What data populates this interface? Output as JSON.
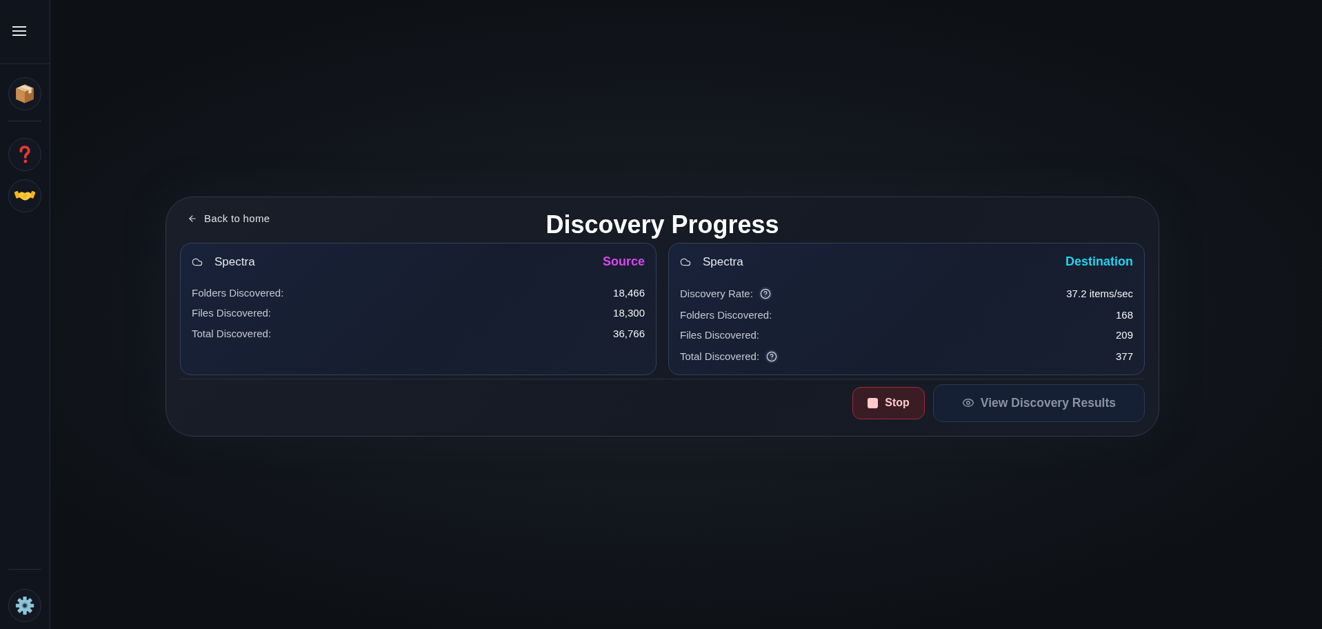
{
  "back_link": {
    "label": "Back to home"
  },
  "title": "Discovery Progress",
  "panels": [
    {
      "name": "Spectra",
      "role": "Source",
      "color": "#d946ef",
      "rows": [
        {
          "label": "Folders Discovered:",
          "value": "18,466",
          "help": false
        },
        {
          "label": "Files Discovered:",
          "value": "18,300",
          "help": false
        },
        {
          "label": "Total Discovered:",
          "value": "36,766",
          "help": false
        }
      ]
    },
    {
      "name": "Spectra",
      "role": "Destination",
      "color": "#22d3ee",
      "rows": [
        {
          "label": "Discovery Rate:",
          "value": "37.2 items/sec",
          "help": true
        },
        {
          "label": "Folders Discovered:",
          "value": "168",
          "help": false
        },
        {
          "label": "Files Discovered:",
          "value": "209",
          "help": false
        },
        {
          "label": "Total Discovered:",
          "value": "377",
          "help": true
        }
      ]
    }
  ],
  "actions": [
    {
      "kind": "stop",
      "label": "Stop",
      "disabled": false
    },
    {
      "kind": "view",
      "label": "View Discovery Results",
      "disabled": true
    }
  ]
}
